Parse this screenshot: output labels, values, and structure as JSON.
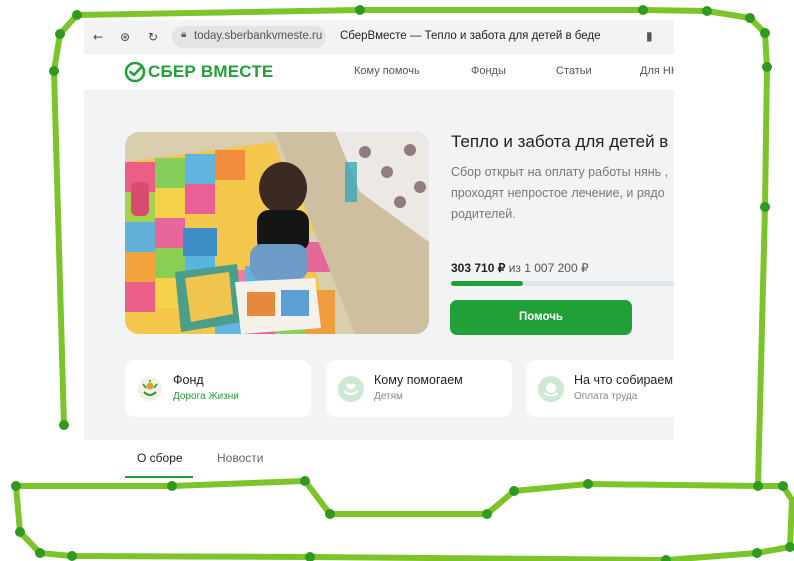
{
  "browser": {
    "url": "today.sberbankvmeste.ru",
    "tab_title": "СберВместе — Тепло и забота для детей в беде",
    "icons": [
      "back-arrow-icon",
      "site-settings-icon",
      "reload-icon",
      "lock-icon",
      "bookmark-icon"
    ]
  },
  "header": {
    "logo_text": "СБЕР ВМЕСТЕ",
    "nav": [
      "Кому помочь",
      "Фонды",
      "Статьи",
      "Для НК"
    ]
  },
  "campaign": {
    "title": "Тепло и забота для детей в",
    "description_lines": [
      "Сбор открыт на оплату работы нянь ,",
      "проходят непростое лечение, и рядо",
      "родителей."
    ],
    "raised": "303 710 ₽",
    "goal_text": "из 1 007 200 ₽",
    "progress_fraction": 0.3015,
    "help_button": "Помочь"
  },
  "cards": [
    {
      "title": "Фонд",
      "subtitle": "Дорога Жизни",
      "icon": "foundation-logo-icon"
    },
    {
      "title": "Кому помогаем",
      "subtitle": "Детям",
      "icon": "hands-heart-icon"
    },
    {
      "title": "На что собираем",
      "subtitle": "Оплата труда",
      "icon": "coins-icon"
    }
  ],
  "tabs": [
    "О сборе",
    "Новости"
  ],
  "colors": {
    "accent": "#21a038",
    "annotation": "#7dc42a"
  }
}
